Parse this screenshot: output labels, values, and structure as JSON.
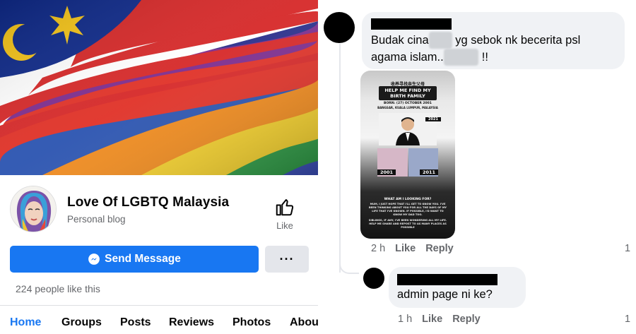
{
  "page": {
    "name": "Love Of LGBTQ Malaysia",
    "category": "Personal blog",
    "like_label": "Like",
    "send_message_label": "Send Message",
    "more_label": "···",
    "likes_count": "224 people like this",
    "tabs": [
      {
        "label": "Home",
        "active": true
      },
      {
        "label": "Groups",
        "active": false
      },
      {
        "label": "Posts",
        "active": false
      },
      {
        "label": "Reviews",
        "active": false
      },
      {
        "label": "Photos",
        "active": false
      },
      {
        "label": "Abou",
        "active": false
      }
    ]
  },
  "comments": [
    {
      "text_before": "Budak cina",
      "redacted_1": "xxxx",
      "text_middle": " yg sebok nk becerita psl agama islam..",
      "redacted_2": "xxxxxx",
      "text_after": " !!",
      "time": "2 h",
      "like_label": "Like",
      "reply_label": "Reply",
      "reaction_count": "1",
      "attachment": {
        "line1": "收养寻找亲生父母",
        "line2": "HELP ME FIND MY",
        "line3": "BIRTH FAMILY",
        "line4": "BORN: (27) OCTOBER 2001",
        "line5": "BANGSAR, KUALA LUMPUR, MALAYSIA",
        "year_2021": "2021",
        "year_2001": "2001",
        "year_2011": "2011",
        "line6": "WHAT AM I LOOKING FOR?",
        "line7": "MUM, I JUST HOPE THAT I'LL GET TO KNOW YOU. I'VE BEEN THINKING ABOUT YOU FOR ALL THE DAYS OF MY LIFE THAT I'VE KNOWN. IF POSSIBLE, I'D WANT TO KNOW MY DAD TOO.",
        "line8": "SIBLINGS, IF ANY, I'VE BEEN WONDERING ALL MY LIFE. HELP ME SHARE AND REPOST TO AS MANY PLACES AS POSSIBLE"
      }
    },
    {
      "text": "admin page ni ke?",
      "time": "1 h",
      "like_label": "Like",
      "reply_label": "Reply",
      "reaction_count": "1"
    }
  ],
  "colors": {
    "facebook_blue": "#1877f2",
    "bubble_gray": "#f0f2f5",
    "meta_gray": "#65676b"
  },
  "icons": [
    "messenger-icon",
    "thumbs-up-icon"
  ]
}
